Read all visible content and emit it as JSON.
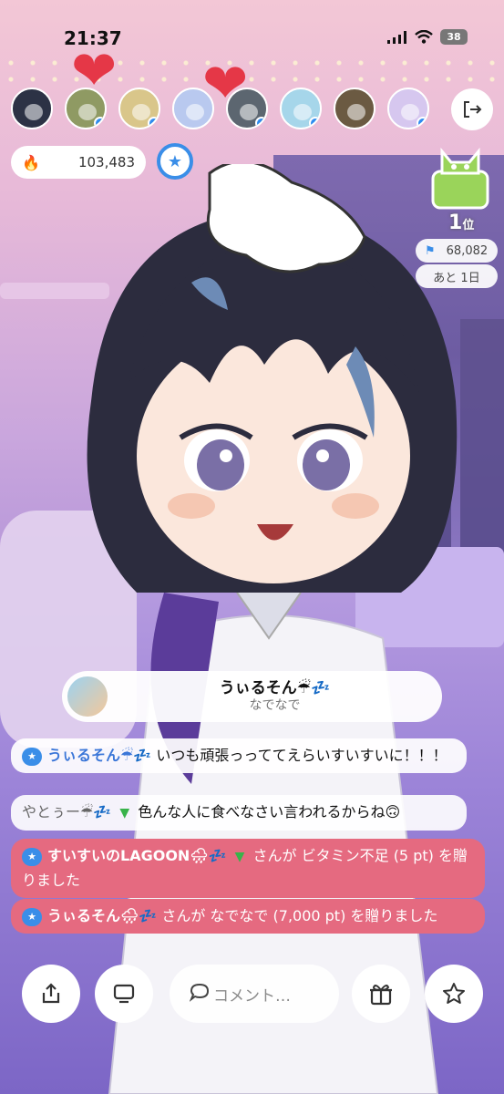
{
  "status_bar": {
    "time": "21:37",
    "battery": "38"
  },
  "viewers": [
    {
      "name": "viewer-1",
      "color": "#2c3245",
      "verified": false
    },
    {
      "name": "viewer-2",
      "color": "#8f9a63",
      "verified": true
    },
    {
      "name": "viewer-3",
      "color": "#d9c68a",
      "verified": true
    },
    {
      "name": "viewer-4",
      "color": "#b9c9ef",
      "verified": false
    },
    {
      "name": "viewer-5",
      "color": "#5c6670",
      "verified": true
    },
    {
      "name": "viewer-6",
      "color": "#a6d6ea",
      "verified": true
    },
    {
      "name": "viewer-7",
      "color": "#6b5a42",
      "verified": false
    },
    {
      "name": "viewer-8",
      "color": "#d6c7ef",
      "verified": true
    }
  ],
  "score": {
    "value": "103,483"
  },
  "ranking": {
    "rank_number": "1",
    "rank_suffix": "位",
    "points": "68,082",
    "remaining": "あと 1日"
  },
  "gift_card": {
    "user": "うぃるそん☔💤",
    "gift_name": "なでなで"
  },
  "comments": [
    {
      "user": "うぃるそん☔💤",
      "text": "いつも頑張っっててえらいすいすいに！！！"
    },
    {
      "user": "やとぅー☔💤",
      "text": "色んな人に食べなさい言われるからね🙃"
    },
    {
      "user": "すいすいのLAGOON🌧💤",
      "text": "さんが ビタミン不足 (5 pt) を贈りました"
    },
    {
      "user": "うぃるそん🌧💤",
      "text": "さんが なでなで (7,000 pt) を贈りました"
    }
  ],
  "bottom_bar": {
    "comment_placeholder": "コメント…"
  },
  "colors": {
    "accent_blue": "#3a8ee8",
    "gift_red": "#e56a80",
    "heart_red": "#e53747"
  }
}
